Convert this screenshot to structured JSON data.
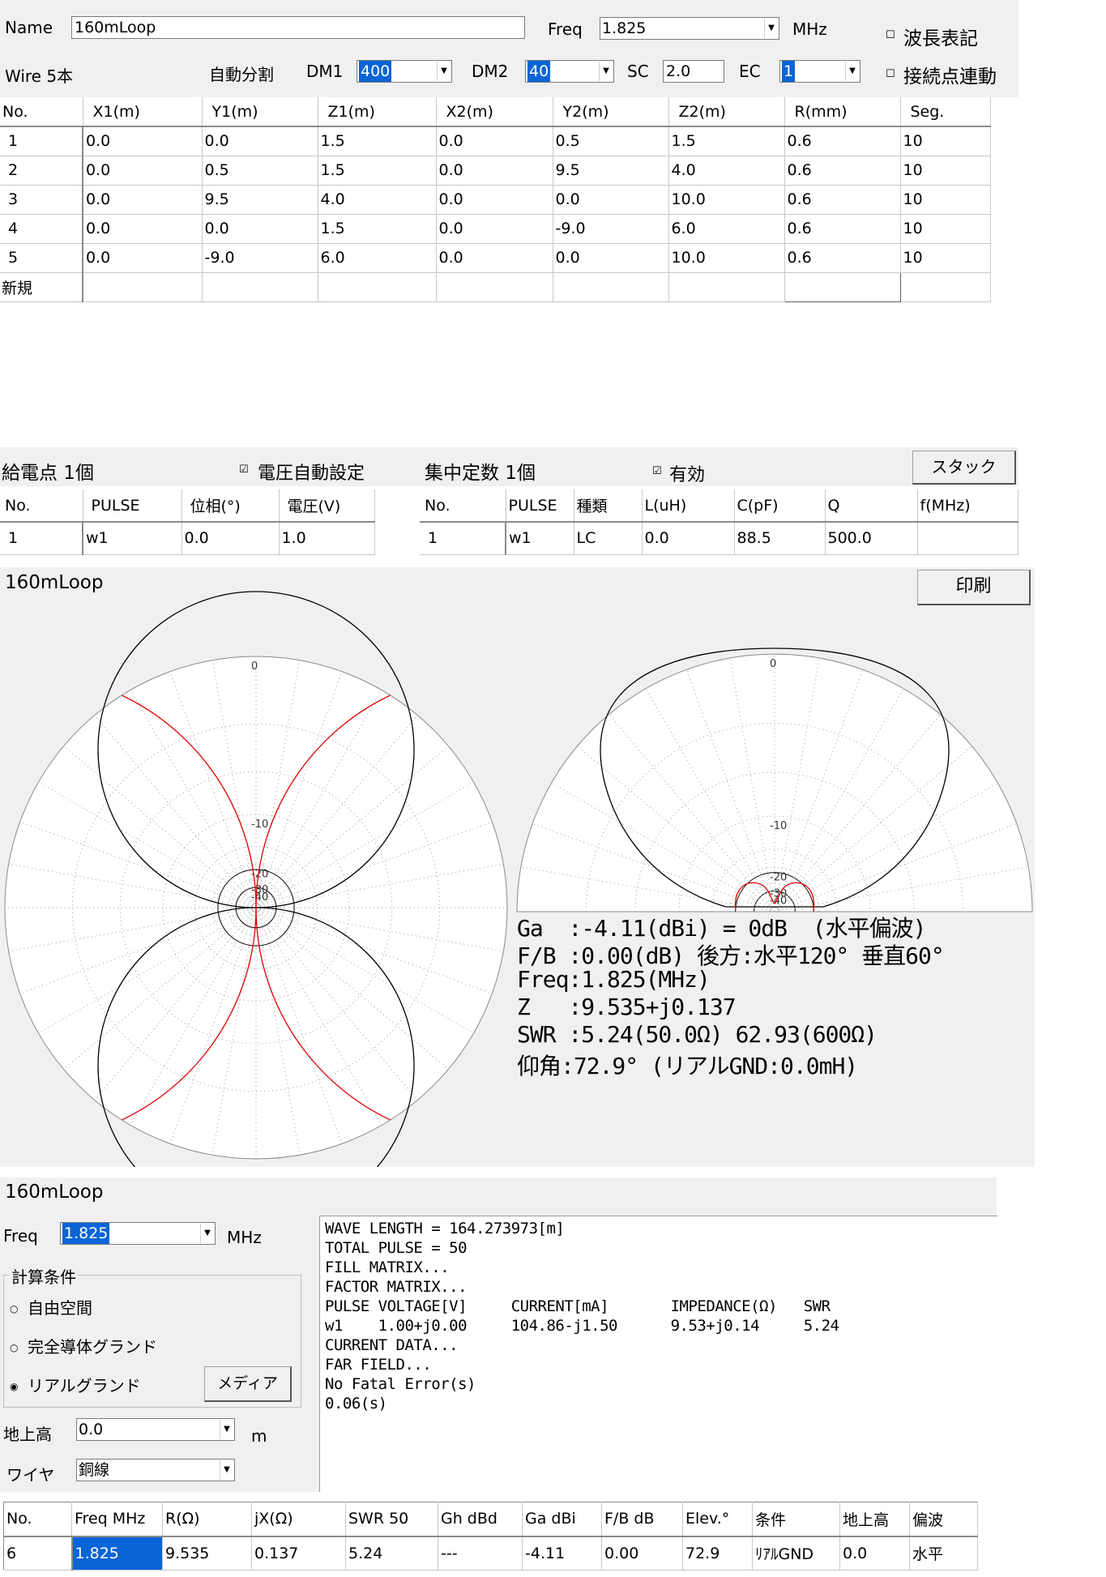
{
  "top": {
    "name_label": "Name",
    "name_value": "160mLoop",
    "freq_label": "Freq",
    "freq_value": "1.825",
    "freq_unit": "MHz",
    "wavelength_label": "波長表記",
    "wire_count": "Wire 5本",
    "auto_split_label": "自動分割",
    "dm1_label": "DM1",
    "dm1_value": "400",
    "dm2_label": "DM2",
    "dm2_value": "40",
    "sc_label": "SC",
    "sc_value": "2.0",
    "ec_label": "EC",
    "ec_value": "1",
    "junction_label": "接続点連動"
  },
  "wires": {
    "headers": [
      "No.",
      "X1(m)",
      "Y1(m)",
      "Z1(m)",
      "X2(m)",
      "Y2(m)",
      "Z2(m)",
      "R(mm)",
      "Seg."
    ],
    "rows": [
      [
        "1",
        "0.0",
        "0.0",
        "1.5",
        "0.0",
        "0.5",
        "1.5",
        "0.6",
        "10"
      ],
      [
        "2",
        "0.0",
        "0.5",
        "1.5",
        "0.0",
        "9.5",
        "4.0",
        "0.6",
        "10"
      ],
      [
        "3",
        "0.0",
        "9.5",
        "4.0",
        "0.0",
        "0.0",
        "10.0",
        "0.6",
        "10"
      ],
      [
        "4",
        "0.0",
        "0.0",
        "1.5",
        "0.0",
        "-9.0",
        "6.0",
        "0.6",
        "10"
      ],
      [
        "5",
        "0.0",
        "-9.0",
        "6.0",
        "0.0",
        "0.0",
        "10.0",
        "0.6",
        "10"
      ]
    ],
    "new_row_label": "新規"
  },
  "feed": {
    "title": "給電点 1個",
    "auto_voltage_label": "電圧自動設定",
    "headers": [
      "No.",
      "PULSE",
      "位相(°)",
      "電圧(V)"
    ],
    "rows": [
      [
        "1",
        "w1",
        "0.0",
        "1.0"
      ]
    ]
  },
  "lumped": {
    "title": "集中定数 1個",
    "enabled_label": "有効",
    "stack_button": "スタック",
    "headers": [
      "No.",
      "PULSE",
      "種類",
      "L(uH)",
      "C(pF)",
      "Q",
      "f(MHz)"
    ],
    "rows": [
      [
        "1",
        "w1",
        "LC",
        "0.0",
        "88.5",
        "500.0",
        ""
      ]
    ]
  },
  "pattern": {
    "title": "160mLoop",
    "print_button": "印刷",
    "ring_labels": [
      "0",
      "-10",
      "-20",
      "-30",
      "-40"
    ],
    "results": [
      "Ga  :-4.11(dBi) = 0dB  (水平偏波)",
      "F/B :0.00(dB) 後方:水平120° 垂直60°",
      "Freq:1.825(MHz)",
      "Z   :9.535+j0.137",
      "SWR :5.24(50.0Ω) 62.93(600Ω)",
      "仰角:72.9° (リアルGND:0.0mH)"
    ],
    "colors": {
      "vertical": "#000000",
      "horizontal": "#e00000",
      "grid": "#9a9a9a"
    }
  },
  "calc": {
    "title": "160mLoop",
    "freq_label": "Freq",
    "freq_value": "1.825",
    "freq_unit": "MHz",
    "conditions_label": "計算条件",
    "free_space": "自由空間",
    "perfect_ground": "完全導体グランド",
    "real_ground": "リアルグランド",
    "media_button": "メディア",
    "height_label": "地上高",
    "height_value": "0.0",
    "height_unit": "m",
    "wire_label": "ワイヤ",
    "wire_value": "銅線",
    "log": [
      "WAVE LENGTH = 164.273973[m]",
      "TOTAL PULSE = 50",
      "FILL MATRIX...",
      "FACTOR MATRIX...",
      "PULSE VOLTAGE[V]     CURRENT[mA]       IMPEDANCE(Ω)   SWR",
      "w1    1.00+j0.00     104.86-j1.50      9.53+j0.14     5.24",
      "CURRENT DATA...",
      "FAR FIELD...",
      "No Fatal Error(s)",
      "0.06(s)"
    ]
  },
  "summary": {
    "headers": [
      "No.",
      "Freq MHz",
      "R(Ω)",
      "jX(Ω)",
      "SWR 50",
      "Gh dBd",
      "Ga dBi",
      "F/B dB",
      "Elev.°",
      "条件",
      "地上高",
      "偏波"
    ],
    "rows": [
      [
        "6",
        "1.825",
        "9.535",
        "0.137",
        "5.24",
        "---",
        "-4.11",
        "0.00",
        "72.9",
        "ﾘｱﾙGND",
        "0.0",
        "水平"
      ]
    ]
  }
}
